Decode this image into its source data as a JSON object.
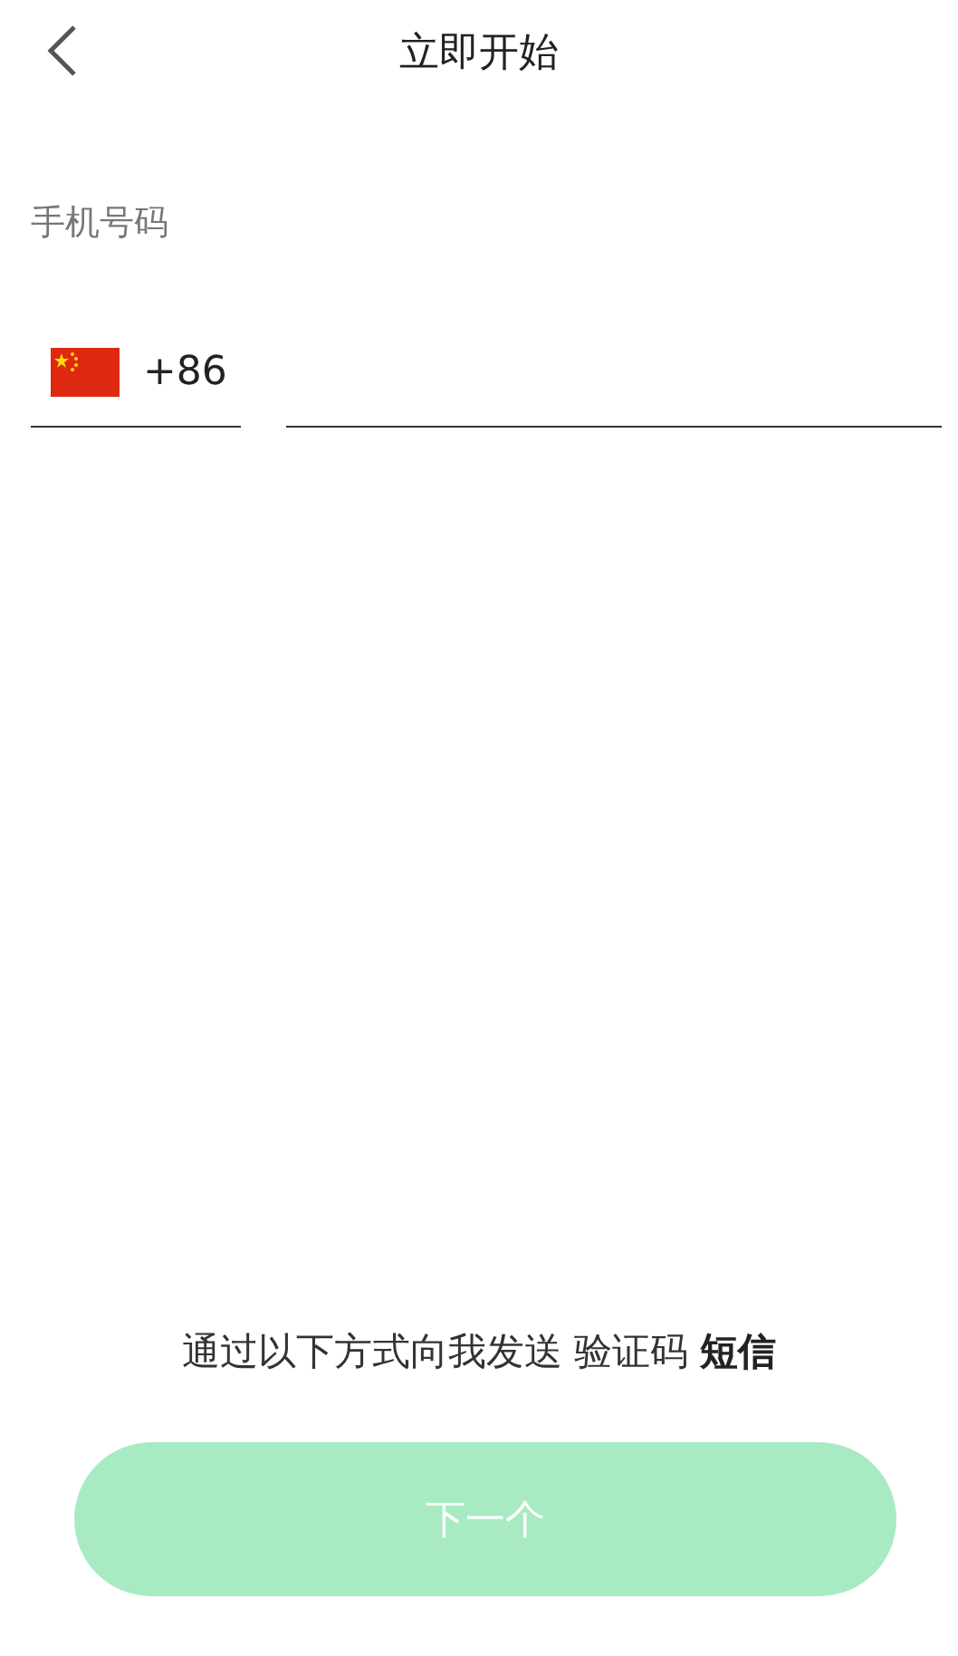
{
  "header": {
    "title": "立即开始"
  },
  "phone": {
    "label": "手机号码",
    "country_code": "+86"
  },
  "notice": "通过以下方式向我发送 验证码 **短信**",
  "next_button": {
    "label": "下一个",
    "disabled": true
  }
}
